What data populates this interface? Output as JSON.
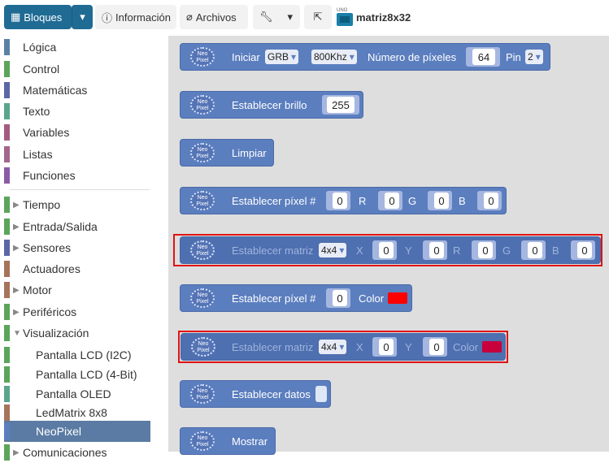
{
  "toolbar": {
    "bloques": "Bloques",
    "info": "Información",
    "files": "Archivos",
    "board_label": "UNO",
    "project": "matriz8x32"
  },
  "sidebar": {
    "items": [
      {
        "label": "Lógica",
        "color": "#5b80a5"
      },
      {
        "label": "Control",
        "color": "#5ba55b"
      },
      {
        "label": "Matemáticas",
        "color": "#5b67a5"
      },
      {
        "label": "Texto",
        "color": "#5ba58c"
      },
      {
        "label": "Variables",
        "color": "#a55b80"
      },
      {
        "label": "Listas",
        "color": "#a5668c"
      },
      {
        "label": "Funciones",
        "color": "#8c5ba5"
      },
      {
        "label": "Tiempo",
        "color": "#5ba55b"
      },
      {
        "label": "Entrada/Salida",
        "color": "#5ba55b"
      },
      {
        "label": "Sensores",
        "color": "#5b67a5"
      },
      {
        "label": "Actuadores",
        "color": "#a5745b"
      },
      {
        "label": "Motor",
        "color": "#a5745b"
      },
      {
        "label": "Periféricos",
        "color": "#5ba55b"
      },
      {
        "label": "Visualización",
        "color": "#5ba55b"
      },
      {
        "label": "Pantalla LCD (I2C)",
        "color": "#5ba55b"
      },
      {
        "label": "Pantalla LCD (4-Bit)",
        "color": "#5ba55b"
      },
      {
        "label": "Pantalla OLED",
        "color": "#5ba58c"
      },
      {
        "label": "LedMatrix 8x8",
        "color": "#a5745b"
      },
      {
        "label": "NeoPixel",
        "color": "#5b7ebf"
      },
      {
        "label": "Comunicaciones",
        "color": "#5ba55b"
      }
    ]
  },
  "blocks": {
    "neo_top": "Neo",
    "neo_bottom": "Pixel",
    "iniciar": {
      "label": "Iniciar",
      "type": "GRB",
      "freq": "800Khz",
      "num_label": "Número de píxeles",
      "num": "64",
      "pin_label": "Pin",
      "pin": "2"
    },
    "brillo": {
      "label": "Establecer brillo",
      "value": "255"
    },
    "limpiar": {
      "label": "Limpiar"
    },
    "pixel_rgb": {
      "label": "Establecer píxel #",
      "idx": "0",
      "r_label": "R",
      "r": "0",
      "g_label": "G",
      "g": "0",
      "b_label": "B",
      "b": "0"
    },
    "matriz_rgb": {
      "label": "Establecer matriz",
      "size": "4x4",
      "x_label": "X",
      "x": "0",
      "y_label": "Y",
      "y": "0",
      "r_label": "R",
      "r": "0",
      "g_label": "G",
      "g": "0",
      "b_label": "B",
      "b": "0"
    },
    "pixel_color": {
      "label": "Establecer píxel #",
      "idx": "0",
      "color_label": "Color",
      "color": "#ff0000"
    },
    "matriz_color": {
      "label": "Establecer matriz",
      "size": "4x4",
      "x_label": "X",
      "x": "0",
      "y_label": "Y",
      "y": "0",
      "color_label": "Color",
      "color": "#c8003c"
    },
    "datos": {
      "label": "Establecer datos"
    },
    "mostrar": {
      "label": "Mostrar"
    }
  }
}
